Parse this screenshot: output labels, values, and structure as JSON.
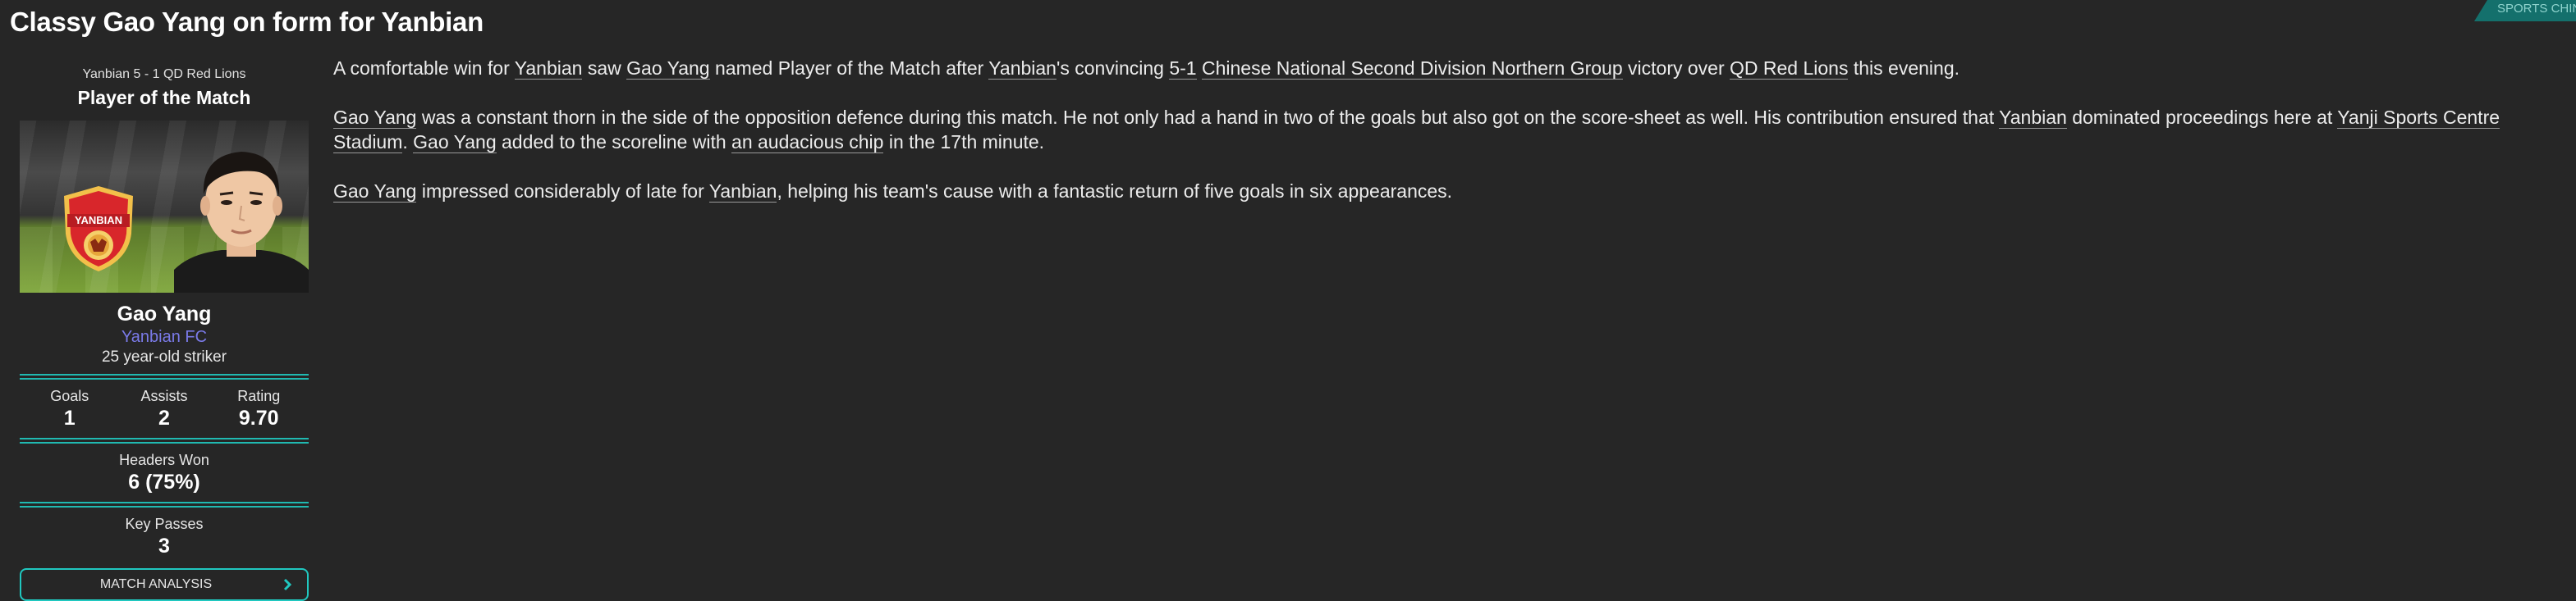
{
  "headline": "Classy Gao Yang on form for Yanbian",
  "source_tag": "SPORTS CHINA",
  "sidebar": {
    "score_line": "Yanbian 5 - 1 QD Red Lions",
    "award_title": "Player of the Match",
    "crest_text": "YANBIAN",
    "player_name": "Gao Yang",
    "club": "Yanbian FC",
    "description": "25 year-old striker",
    "stats": [
      {
        "label": "Goals",
        "value": "1"
      },
      {
        "label": "Assists",
        "value": "2"
      },
      {
        "label": "Rating",
        "value": "9.70"
      }
    ],
    "headers_won": {
      "label": "Headers Won",
      "value": "6 (75%)"
    },
    "key_passes": {
      "label": "Key Passes",
      "value": "3"
    },
    "button_label": "MATCH ANALYSIS"
  },
  "article": {
    "p1": {
      "a": "A comfortable win for ",
      "team": "Yanbian",
      "b": " saw ",
      "player": "Gao Yang",
      "c": " named Player of the Match after ",
      "team2": "Yanbian",
      "d": "'s convincing ",
      "score": "5-1",
      "e": " ",
      "competition": "Chinese National Second Division Northern Group",
      "f": " victory over ",
      "opponent": "QD Red Lions",
      "g": " this evening."
    },
    "p2": {
      "player": "Gao Yang",
      "a": " was a constant thorn in the side of the opposition defence during this match. He not only had a hand in two of the goals but also got on the score-sheet as well. His contribution ensured that ",
      "team": "Yanbian",
      "b": " dominated proceedings here at ",
      "stadium": "Yanji Sports Centre Stadium",
      "c": ". ",
      "player2": "Gao Yang",
      "d": " added to the scoreline with ",
      "goal": "an audacious chip",
      "e": " in the 17th minute."
    },
    "p3": {
      "player": "Gao Yang",
      "a": " impressed considerably of late for ",
      "team": "Yanbian",
      "b": ", helping his team's cause with a fantastic return of five goals in six appearances."
    }
  },
  "colors": {
    "background": "#262626",
    "accent": "#20b9b1",
    "club_link": "#7a7ae8",
    "crest_red": "#d8262b"
  },
  "icons": [
    "club-crest-icon",
    "chevron-right-icon"
  ]
}
